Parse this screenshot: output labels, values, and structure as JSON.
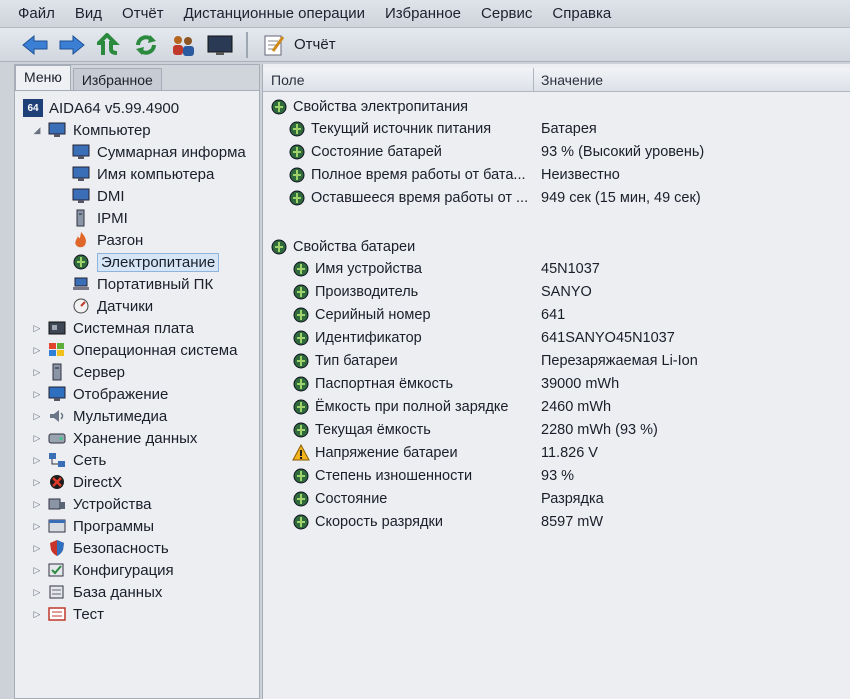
{
  "menu": [
    "Файл",
    "Вид",
    "Отчёт",
    "Дистанционные операции",
    "Избранное",
    "Сервис",
    "Справка"
  ],
  "toolbar": {
    "report_label": "Отчёт"
  },
  "left": {
    "tabs": [
      "Меню",
      "Избранное"
    ],
    "root": "AIDA64 v5.99.4900",
    "root_badge": "64",
    "computer": "Компьютер",
    "computer_children": [
      "Суммарная информа",
      "Имя компьютера",
      "DMI",
      "IPMI",
      "Разгон",
      "Электропитание",
      "Портативный ПК",
      "Датчики"
    ],
    "categories": [
      "Системная плата",
      "Операционная система",
      "Сервер",
      "Отображение",
      "Мультимедиа",
      "Хранение данных",
      "Сеть",
      "DirectX",
      "Устройства",
      "Программы",
      "Безопасность",
      "Конфигурация",
      "База данных",
      "Тест"
    ]
  },
  "right": {
    "col_field": "Поле",
    "col_value": "Значение",
    "section1": "Свойства электропитания",
    "power": [
      {
        "field": "Текущий источник питания",
        "value": "Батарея"
      },
      {
        "field": "Состояние батарей",
        "value": "93 % (Высокий уровень)"
      },
      {
        "field": "Полное время работы от бата...",
        "value": "Неизвестно"
      },
      {
        "field": "Оставшееся время работы от ...",
        "value": "949 сек (15 мин, 49 сек)"
      }
    ],
    "section2": "Свойства батареи",
    "battery": [
      {
        "field": "Имя устройства",
        "value": "45N1037"
      },
      {
        "field": "Производитель",
        "value": "SANYO"
      },
      {
        "field": "Серийный номер",
        "value": "641"
      },
      {
        "field": "Идентификатор",
        "value": "641SANYO45N1037"
      },
      {
        "field": "Тип батареи",
        "value": "Перезаряжаемая Li-Ion"
      },
      {
        "field": "Паспортная ёмкость",
        "value": "39000 mWh"
      },
      {
        "field": "Ёмкость при полной зарядке",
        "value": "2460 mWh"
      },
      {
        "field": "Текущая ёмкость",
        "value": "2280 mWh  (93 %)"
      },
      {
        "field": "Напряжение батареи",
        "value": "11.826 V"
      },
      {
        "field": "Степень изношенности",
        "value": "93 %"
      },
      {
        "field": "Состояние",
        "value": "Разрядка"
      },
      {
        "field": "Скорость разрядки",
        "value": "8597 mW"
      }
    ]
  }
}
